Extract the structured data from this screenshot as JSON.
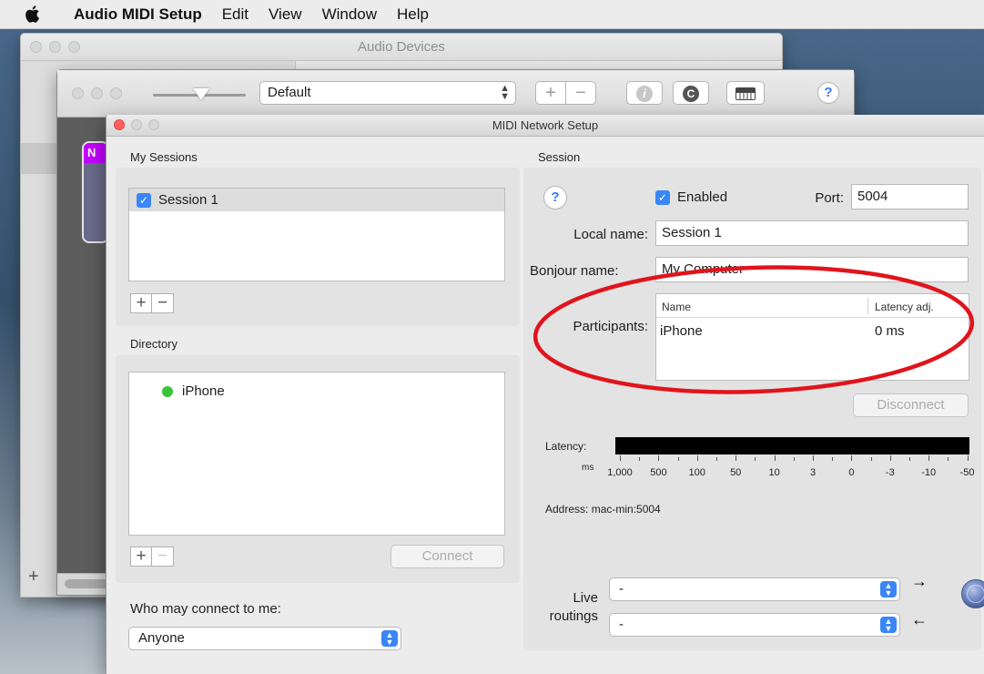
{
  "menubar": {
    "app_name": "Audio MIDI Setup",
    "items": [
      "Edit",
      "View",
      "Window",
      "Help"
    ]
  },
  "audio_window": {
    "title": "Audio Devices",
    "add_label": "+"
  },
  "midi_studio": {
    "configuration": "Default",
    "add_label": "+",
    "remove_label": "−",
    "info_label": "i",
    "rescan_label": "C",
    "help_label": "?",
    "device_badge": "N"
  },
  "network_window": {
    "title": "MIDI Network Setup",
    "my_sessions": {
      "label": "My Sessions",
      "sessions": [
        {
          "name": "Session 1",
          "checked": true
        }
      ],
      "add_label": "+",
      "remove_label": "−"
    },
    "directory": {
      "label": "Directory",
      "items": [
        {
          "name": "iPhone",
          "status_color": "#36c536"
        }
      ],
      "add_label": "+",
      "remove_label": "−",
      "connect_label": "Connect"
    },
    "who_may_connect": {
      "label": "Who may connect to me:",
      "value": "Anyone"
    },
    "session": {
      "label": "Session",
      "help_label": "?",
      "enabled_label": "Enabled",
      "port_label": "Port:",
      "port_value": "5004",
      "local_name_label": "Local name:",
      "local_name_value": "Session 1",
      "bonjour_name_label": "Bonjour name:",
      "bonjour_name_value": "My Computer",
      "participants_label": "Participants:",
      "participants_columns": [
        "Name",
        "Latency adj."
      ],
      "participants": [
        {
          "name": "iPhone",
          "latency": "0 ms"
        }
      ],
      "disconnect_label": "Disconnect",
      "latency_label": "Latency:",
      "ms_label": "ms",
      "scale_labels": [
        "1,000",
        "500",
        "100",
        "50",
        "10",
        "3",
        "0",
        "-3",
        "-10",
        "-50"
      ],
      "address_label": "Address:",
      "address_value": "mac-min:5004",
      "live_routings_label_1": "Live",
      "live_routings_label_2": "routings",
      "routing_in_value": "-",
      "routing_out_value": "-",
      "arrow_out": "→",
      "arrow_in": "←"
    }
  },
  "colors": {
    "accent": "#3a86f7",
    "annotation": "#e0141c",
    "close_button": "#fc605c",
    "status_online": "#36c536"
  }
}
